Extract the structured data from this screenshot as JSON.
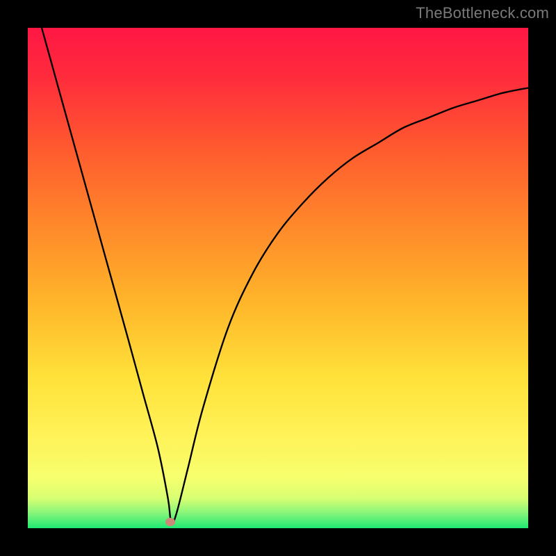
{
  "watermark": {
    "text": "TheBottleneck.com"
  },
  "chart_data": {
    "type": "line",
    "title": "",
    "xlabel": "",
    "ylabel": "",
    "xlim": [
      0,
      100
    ],
    "ylim": [
      0,
      100
    ],
    "grid": false,
    "legend": false,
    "gradient_stops": [
      {
        "offset": 0.0,
        "color": "#ff1744"
      },
      {
        "offset": 0.1,
        "color": "#ff2c3c"
      },
      {
        "offset": 0.25,
        "color": "#ff5d2e"
      },
      {
        "offset": 0.4,
        "color": "#ff8a2a"
      },
      {
        "offset": 0.55,
        "color": "#ffb62a"
      },
      {
        "offset": 0.7,
        "color": "#ffe23a"
      },
      {
        "offset": 0.82,
        "color": "#fff35a"
      },
      {
        "offset": 0.9,
        "color": "#f6ff6e"
      },
      {
        "offset": 0.94,
        "color": "#d8ff72"
      },
      {
        "offset": 0.97,
        "color": "#86f57a"
      },
      {
        "offset": 1.0,
        "color": "#1ee873"
      }
    ],
    "series": [
      {
        "name": "bottleneck-curve",
        "color": "#000000",
        "stroke_width": 2.4,
        "x": [
          0,
          5,
          10,
          15,
          20,
          23,
          26,
          28,
          28.5,
          29,
          30,
          32,
          35,
          40,
          45,
          50,
          55,
          60,
          65,
          70,
          75,
          80,
          85,
          90,
          95,
          100
        ],
        "values": [
          110,
          92,
          74,
          56,
          38,
          27,
          16,
          6,
          2,
          1,
          4,
          12,
          24,
          40,
          51,
          59,
          65,
          70,
          74,
          77,
          80,
          82,
          84,
          85.5,
          87,
          88
        ]
      }
    ],
    "marker": {
      "x": 28.5,
      "y": 1.2,
      "color": "#cb8a78"
    }
  }
}
